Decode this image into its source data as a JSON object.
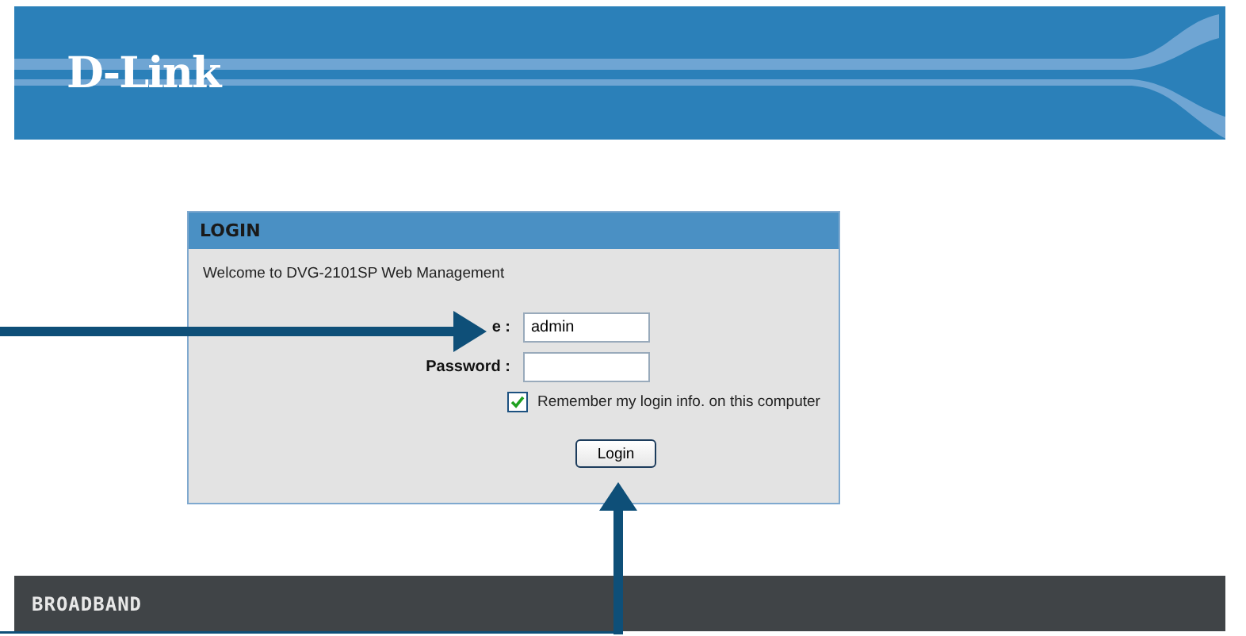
{
  "header": {
    "logo": "D-Link"
  },
  "login": {
    "title": "LOGIN",
    "welcome": "Welcome to DVG-2101SP Web Management",
    "fields": [
      {
        "label": "e :",
        "value": "admin"
      },
      {
        "label": "Password :"
      }
    ],
    "remember": {
      "label": "Remember my login info. on this computer",
      "checked": true
    },
    "button": "Login"
  },
  "footer": {
    "label": "BROADBAND"
  }
}
